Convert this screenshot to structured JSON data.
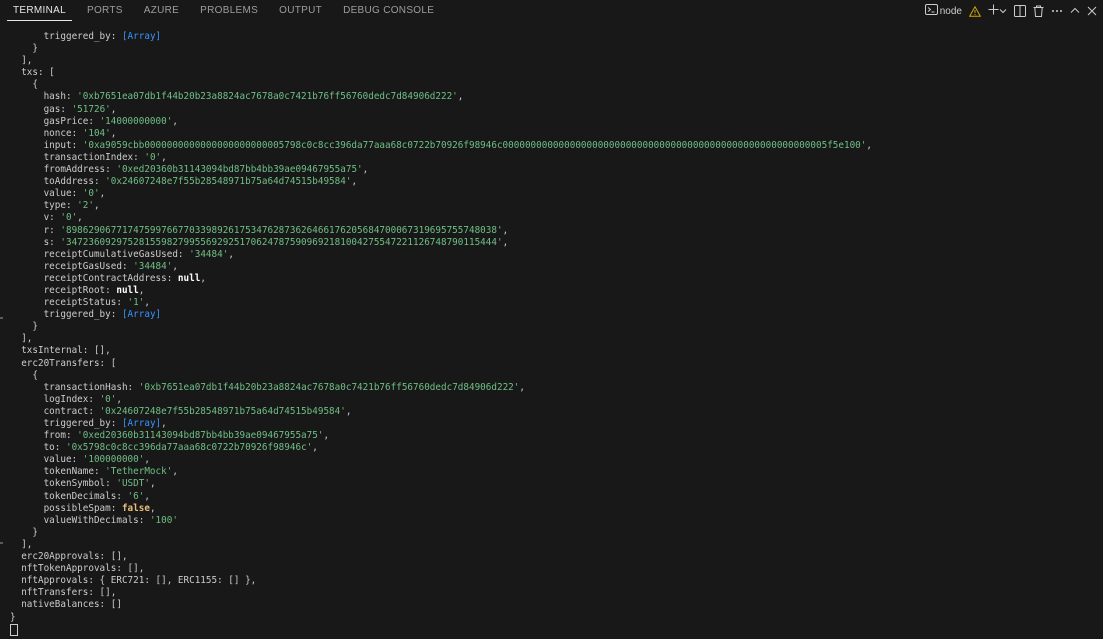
{
  "tabs": [
    "TERMINAL",
    "PORTS",
    "AZURE",
    "PROBLEMS",
    "OUTPUT",
    "DEBUG CONSOLE"
  ],
  "active_tab": "TERMINAL",
  "toolbar": {
    "terminal_name": "node",
    "icons": [
      "terminal-icon",
      "warning-icon",
      "add-icon",
      "chevron-down-icon",
      "split-icon",
      "trash-icon",
      "more-icon",
      "maximize-icon",
      "close-icon"
    ]
  },
  "terminal": {
    "lines": [
      [
        [
          "      triggered_by: ",
          ""
        ],
        [
          "[Array]",
          "a"
        ]
      ],
      [
        [
          "    }",
          ""
        ]
      ],
      [
        [
          "  ],",
          ""
        ]
      ],
      [
        [
          "  txs: [",
          ""
        ]
      ],
      [
        [
          "    {",
          ""
        ]
      ],
      [
        [
          "      hash: ",
          ""
        ],
        [
          "'0xb7651ea07db1f44b20b23a8824ac7678a0c7421b76ff56760dedc7d84906d222'",
          "s"
        ],
        [
          ",",
          ""
        ]
      ],
      [
        [
          "      gas: ",
          ""
        ],
        [
          "'51726'",
          "s"
        ],
        [
          ",",
          ""
        ]
      ],
      [
        [
          "      gasPrice: ",
          ""
        ],
        [
          "'14000000000'",
          "s"
        ],
        [
          ",",
          ""
        ]
      ],
      [
        [
          "      nonce: ",
          ""
        ],
        [
          "'104'",
          "s"
        ],
        [
          ",",
          ""
        ]
      ],
      [
        [
          "      input: ",
          ""
        ],
        [
          "'0xa9059cbb0000000000000000000000005798c0c8cc396da77aaa68c0722b70926f98946c0000000000000000000000000000000000000000000000000000000005f5e100'",
          "s"
        ],
        [
          ",",
          ""
        ]
      ],
      [
        [
          "      transactionIndex: ",
          ""
        ],
        [
          "'0'",
          "s"
        ],
        [
          ",",
          ""
        ]
      ],
      [
        [
          "      fromAddress: ",
          ""
        ],
        [
          "'0xed20360b31143094bd87bb4bb39ae09467955a75'",
          "s"
        ],
        [
          ",",
          ""
        ]
      ],
      [
        [
          "      toAddress: ",
          ""
        ],
        [
          "'0x24607248e7f55b28548971b75a64d74515b49584'",
          "s"
        ],
        [
          ",",
          ""
        ]
      ],
      [
        [
          "      value: ",
          ""
        ],
        [
          "'0'",
          "s"
        ],
        [
          ",",
          ""
        ]
      ],
      [
        [
          "      type: ",
          ""
        ],
        [
          "'2'",
          "s"
        ],
        [
          ",",
          ""
        ]
      ],
      [
        [
          "      v: ",
          ""
        ],
        [
          "'0'",
          "s"
        ],
        [
          ",",
          ""
        ]
      ],
      [
        [
          "      r: ",
          ""
        ],
        [
          "'89862906771747599766770339892617534762873626466176205684700067319695755748038'",
          "s"
        ],
        [
          ",",
          ""
        ]
      ],
      [
        [
          "      s: ",
          ""
        ],
        [
          "'34723609297528155982799556929251706247875909692181004275547221126748790115444'",
          "s"
        ],
        [
          ",",
          ""
        ]
      ],
      [
        [
          "      receiptCumulativeGasUsed: ",
          ""
        ],
        [
          "'34484'",
          "s"
        ],
        [
          ",",
          ""
        ]
      ],
      [
        [
          "      receiptGasUsed: ",
          ""
        ],
        [
          "'34484'",
          "s"
        ],
        [
          ",",
          ""
        ]
      ],
      [
        [
          "      receiptContractAddress: ",
          ""
        ],
        [
          "null",
          "n"
        ],
        [
          ",",
          ""
        ]
      ],
      [
        [
          "      receiptRoot: ",
          ""
        ],
        [
          "null",
          "n"
        ],
        [
          ",",
          ""
        ]
      ],
      [
        [
          "      receiptStatus: ",
          ""
        ],
        [
          "'1'",
          "s"
        ],
        [
          ",",
          ""
        ]
      ],
      [
        [
          "      triggered_by: ",
          ""
        ],
        [
          "[Array]",
          "a"
        ]
      ],
      [
        [
          "    }",
          ""
        ]
      ],
      [
        [
          "  ],",
          ""
        ]
      ],
      [
        [
          "  txsInternal: [],",
          ""
        ]
      ],
      [
        [
          "  erc20Transfers: [",
          ""
        ]
      ],
      [
        [
          "    {",
          ""
        ]
      ],
      [
        [
          "      transactionHash: ",
          ""
        ],
        [
          "'0xb7651ea07db1f44b20b23a8824ac7678a0c7421b76ff56760dedc7d84906d222'",
          "s"
        ],
        [
          ",",
          ""
        ]
      ],
      [
        [
          "      logIndex: ",
          ""
        ],
        [
          "'0'",
          "s"
        ],
        [
          ",",
          ""
        ]
      ],
      [
        [
          "      contract: ",
          ""
        ],
        [
          "'0x24607248e7f55b28548971b75a64d74515b49584'",
          "s"
        ],
        [
          ",",
          ""
        ]
      ],
      [
        [
          "      triggered_by: ",
          ""
        ],
        [
          "[Array]",
          "a"
        ],
        [
          ",",
          ""
        ]
      ],
      [
        [
          "      from: ",
          ""
        ],
        [
          "'0xed20360b31143094bd87bb4bb39ae09467955a75'",
          "s"
        ],
        [
          ",",
          ""
        ]
      ],
      [
        [
          "      to: ",
          ""
        ],
        [
          "'0x5798c0c8cc396da77aaa68c0722b70926f98946c'",
          "s"
        ],
        [
          ",",
          ""
        ]
      ],
      [
        [
          "      value: ",
          ""
        ],
        [
          "'100000000'",
          "s"
        ],
        [
          ",",
          ""
        ]
      ],
      [
        [
          "      tokenName: ",
          ""
        ],
        [
          "'TetherMock'",
          "s"
        ],
        [
          ",",
          ""
        ]
      ],
      [
        [
          "      tokenSymbol: ",
          ""
        ],
        [
          "'USDT'",
          "s"
        ],
        [
          ",",
          ""
        ]
      ],
      [
        [
          "      tokenDecimals: ",
          ""
        ],
        [
          "'6'",
          "s"
        ],
        [
          ",",
          ""
        ]
      ],
      [
        [
          "      possibleSpam: ",
          ""
        ],
        [
          "false",
          "b"
        ],
        [
          ",",
          ""
        ]
      ],
      [
        [
          "      valueWithDecimals: ",
          ""
        ],
        [
          "'100'",
          "s"
        ]
      ],
      [
        [
          "    }",
          ""
        ]
      ],
      [
        [
          "  ],",
          ""
        ]
      ],
      [
        [
          "  erc20Approvals: [],",
          ""
        ]
      ],
      [
        [
          "  nftTokenApprovals: [],",
          ""
        ]
      ],
      [
        [
          "  nftApprovals: { ERC721: [], ERC1155: [] },",
          ""
        ]
      ],
      [
        [
          "  nftTransfers: [],",
          ""
        ]
      ],
      [
        [
          "  nativeBalances: []",
          ""
        ]
      ],
      [
        [
          "}",
          ""
        ]
      ]
    ]
  }
}
